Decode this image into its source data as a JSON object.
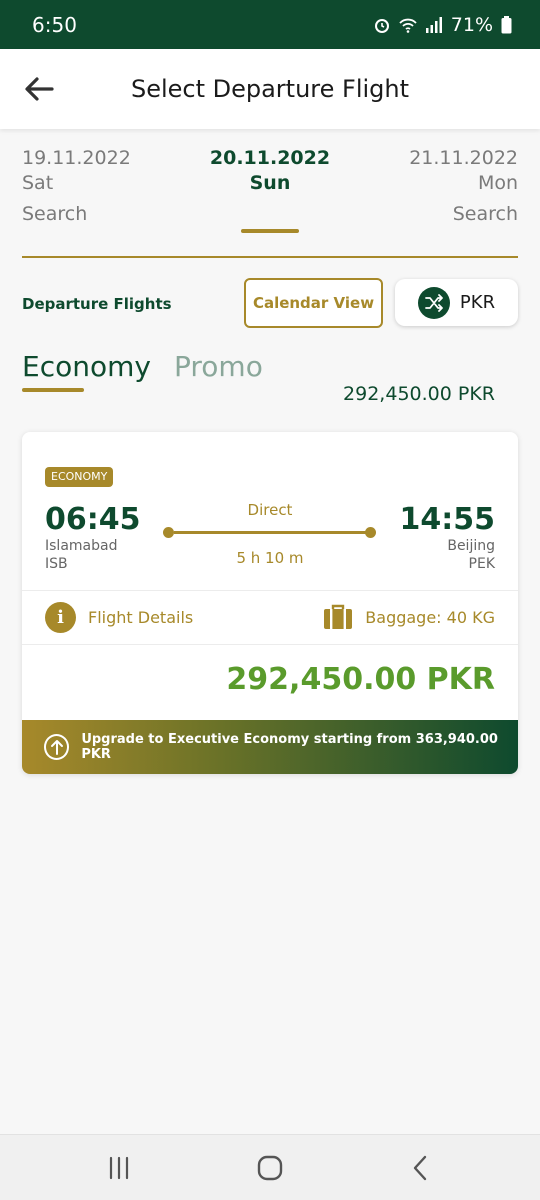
{
  "status_bar": {
    "time": "6:50",
    "battery": "71%",
    "icons": [
      "alarm-icon",
      "wifi-icon",
      "signal-icon",
      "battery-icon"
    ]
  },
  "header": {
    "title": "Select Departure Flight",
    "back_icon": "back-arrow-icon"
  },
  "dates": {
    "prev": {
      "date": "19.11.2022",
      "day": "Sat",
      "action": "Search"
    },
    "current": {
      "date": "20.11.2022",
      "day": "Sun",
      "price": "292,450.00 PKR"
    },
    "next": {
      "date": "21.11.2022",
      "day": "Mon",
      "action": "Search"
    }
  },
  "toolbar": {
    "departure_label": "Departure Flights",
    "calendar_button": "Calendar View",
    "currency_button": "PKR"
  },
  "tabs": [
    {
      "label": "Economy",
      "active": true
    },
    {
      "label": "Promo",
      "active": false
    }
  ],
  "flight": {
    "badge": "ECONOMY",
    "departure_time": "06:45",
    "departure_city": "Islamabad",
    "departure_code": "ISB",
    "arrival_time": "14:55",
    "arrival_city": "Beijing",
    "arrival_code": "PEK",
    "stop_type": "Direct",
    "duration": "5 h 10 m",
    "details_label": "Flight Details",
    "baggage_label": "Baggage: 40 KG",
    "price": "292,450.00 PKR",
    "upgrade_text": "Upgrade to Executive Economy starting from 363,940.00 PKR"
  },
  "colors": {
    "primary_green": "#0e4a2e",
    "gold": "#a7892a",
    "price_green": "#5a9b2c"
  }
}
